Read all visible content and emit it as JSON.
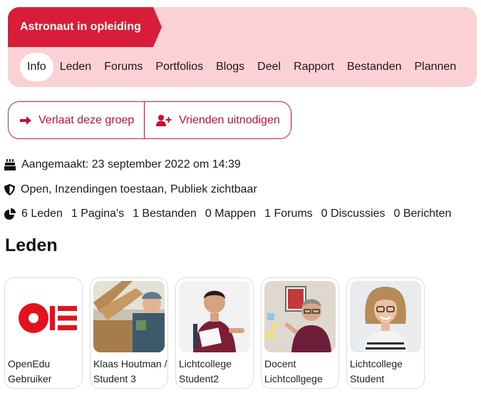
{
  "group": {
    "title": "Astronaut in opleiding",
    "tabs": [
      "Info",
      "Leden",
      "Forums",
      "Portfolios",
      "Blogs",
      "Deel",
      "Rapport",
      "Bestanden",
      "Plannen"
    ]
  },
  "actions": {
    "leave_label": "Verlaat deze groep",
    "invite_label": "Vrienden uitnodigen"
  },
  "meta": {
    "created": "Aangemaakt: 23 september 2022 om 14:39",
    "settings": "Open, Inzendingen toestaan, Publiek zichtbaar",
    "stats": [
      "6 Leden",
      "1 Pagina's",
      "1 Bestanden",
      "0 Mappen",
      "1 Forums",
      "0 Discussies",
      "0 Berichten"
    ]
  },
  "members_section": {
    "title": "Leden",
    "members": [
      {
        "name": "OpenEdu Gebruiker",
        "avatar": "openedu-logo"
      },
      {
        "name": "Klaas Houtman / Student 3",
        "avatar": "photo-worker"
      },
      {
        "name": "Lichtcollege Student2",
        "avatar": "photo-student-man"
      },
      {
        "name": "Docent Lichtcollgege",
        "avatar": "photo-teacher"
      },
      {
        "name": "Lichtcollege Student",
        "avatar": "photo-student-woman"
      }
    ]
  },
  "colors": {
    "brand_red": "#d81d38",
    "header_pink": "#fcd1d6"
  }
}
